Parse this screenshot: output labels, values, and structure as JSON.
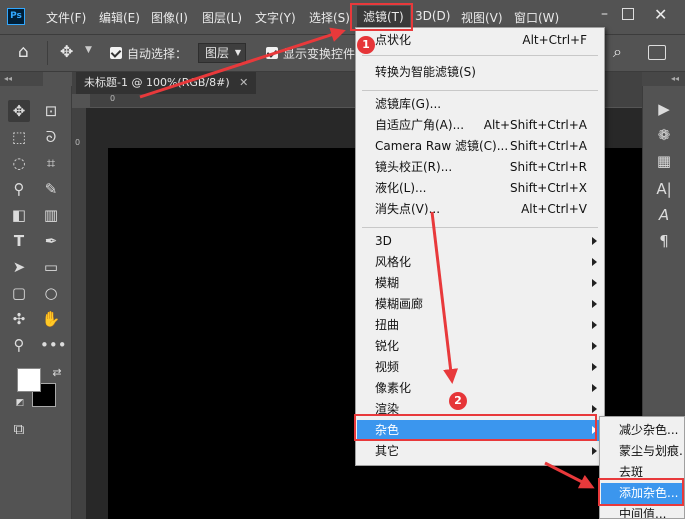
{
  "app": {
    "logo": "Ps"
  },
  "menubar": {
    "items": [
      "文件(F)",
      "编辑(E)",
      "图像(I)",
      "图层(L)",
      "文字(Y)",
      "选择(S)",
      "滤镜(T)",
      "3D(D)",
      "视图(V)",
      "窗口(W)"
    ],
    "active": "滤镜(T)"
  },
  "options_bar": {
    "auto_select_label": "自动选择：",
    "auto_select_value": "图层",
    "show_transform_label": "显示变换控件"
  },
  "document": {
    "tab_title": "未标题-1 @ 100%(RGB/8#)",
    "ruler_zero": "0"
  },
  "colors": {
    "foreground": "#ffffff",
    "background": "#000000",
    "highlight": "#3b96ee",
    "annotation": "#e8393b"
  },
  "filter_menu": {
    "top_items": [
      {
        "label": "点状化",
        "shortcut": "Alt+Ctrl+F"
      },
      {
        "label": "转换为智能滤镜(S)",
        "shortcut": ""
      }
    ],
    "mid_items": [
      {
        "label": "滤镜库(G)...",
        "shortcut": ""
      },
      {
        "label": "自适应广角(A)...",
        "shortcut": "Alt+Shift+Ctrl+A"
      },
      {
        "label": "Camera Raw 滤镜(C)...",
        "shortcut": "Shift+Ctrl+A"
      },
      {
        "label": "镜头校正(R)...",
        "shortcut": "Shift+Ctrl+R"
      },
      {
        "label": "液化(L)...",
        "shortcut": "Shift+Ctrl+X"
      },
      {
        "label": "消失点(V)...",
        "shortcut": "Alt+Ctrl+V"
      }
    ],
    "submenu_items": [
      "3D",
      "风格化",
      "模糊",
      "模糊画廊",
      "扭曲",
      "锐化",
      "视频",
      "像素化",
      "渲染",
      "杂色",
      "其它"
    ],
    "highlighted": "杂色"
  },
  "noise_submenu": {
    "items": [
      "减少杂色...",
      "蒙尘与划痕...",
      "去斑",
      "添加杂色...",
      "中间值..."
    ],
    "highlighted": "添加杂色..."
  },
  "annotations": {
    "step1": "1",
    "step2": "2"
  }
}
